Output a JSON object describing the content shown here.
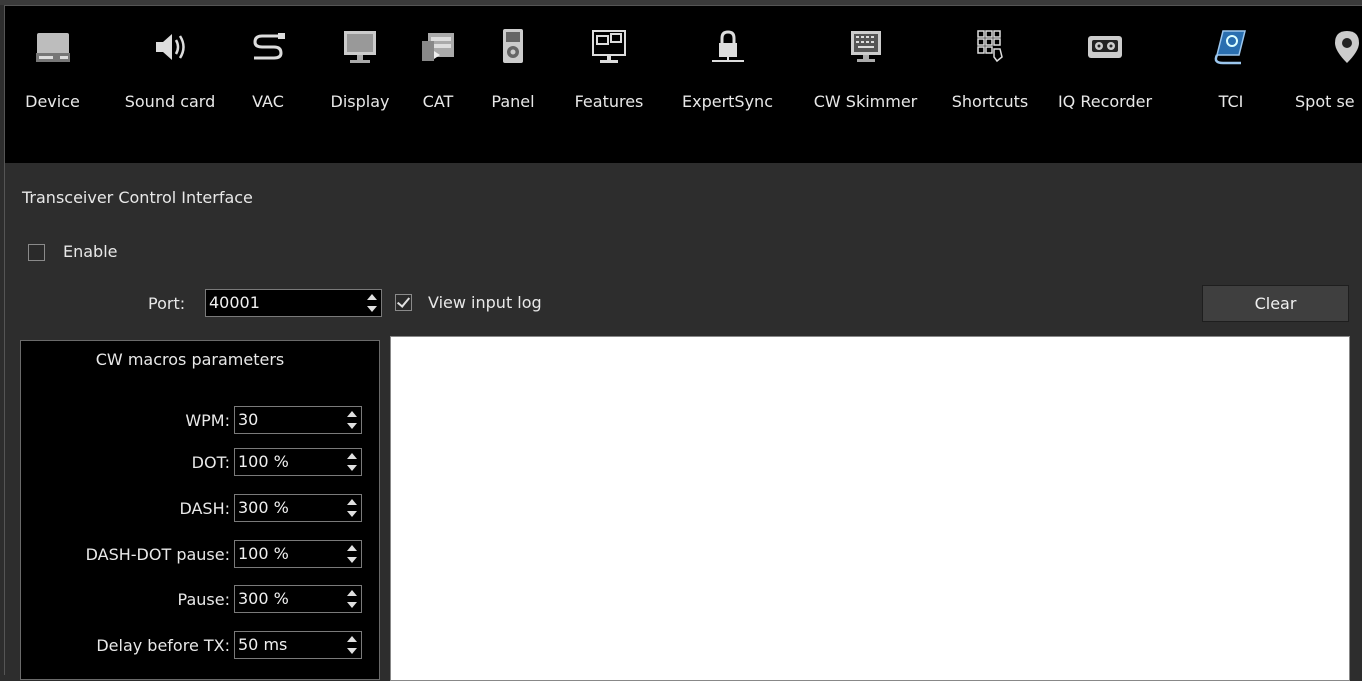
{
  "toolbar": {
    "items": [
      {
        "label": "Device",
        "icon": "device-icon"
      },
      {
        "label": "Sound card",
        "icon": "speaker-icon"
      },
      {
        "label": "VAC",
        "icon": "cable-icon"
      },
      {
        "label": "Display",
        "icon": "monitor-icon"
      },
      {
        "label": "CAT",
        "icon": "cat-icon"
      },
      {
        "label": "Panel",
        "icon": "panel-icon"
      },
      {
        "label": "Features",
        "icon": "features-icon"
      },
      {
        "label": "ExpertSync",
        "icon": "lock-icon"
      },
      {
        "label": "CW Skimmer",
        "icon": "keyboard-monitor-icon"
      },
      {
        "label": "Shortcuts",
        "icon": "shortcuts-icon"
      },
      {
        "label": "IQ Recorder",
        "icon": "tape-icon"
      },
      {
        "label": "TCI",
        "icon": "tci-icon"
      },
      {
        "label": "Spot se",
        "icon": "map-pin-icon"
      }
    ]
  },
  "page": {
    "title": "Transceiver Control Interface",
    "enable_label": "Enable",
    "enable_checked": false,
    "port_label": "Port:",
    "port_value": "40001",
    "view_log_label": "View input log",
    "view_log_checked": true,
    "clear_label": "Clear"
  },
  "cw_macros": {
    "title": "CW macros parameters",
    "params": [
      {
        "label": "WPM:",
        "value": "30"
      },
      {
        "label": "DOT:",
        "value": "100 %"
      },
      {
        "label": "DASH:",
        "value": "300 %"
      },
      {
        "label": "DASH-DOT pause:",
        "value": "100 %"
      },
      {
        "label": "Pause:",
        "value": "300 %"
      },
      {
        "label": "Delay before TX:",
        "value": "50 ms"
      }
    ]
  },
  "colors": {
    "background": "#2d2d2d",
    "toolbar": "#000000",
    "log_background": "#ffffff"
  }
}
